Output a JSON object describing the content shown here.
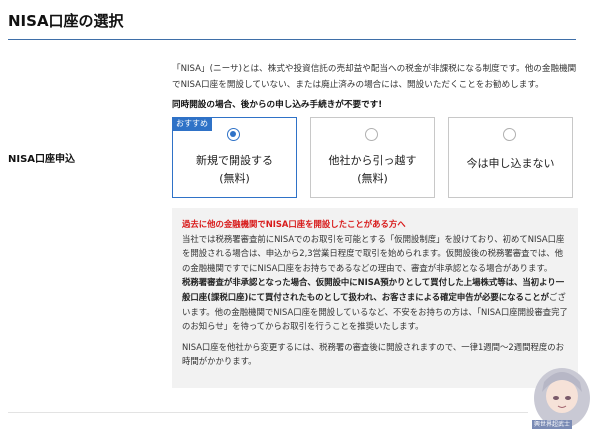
{
  "section": {
    "title": "NISA口座の選択"
  },
  "intro": {
    "text": "「NISA」(ニーサ)とは、株式や投資信託の売却益や配当への税金が非課税になる制度です。他の金融機関でNISA口座を開設していない、または廃止済みの場合には、開設いただくことをお勧めします。",
    "notice": "同時開設の場合、後からの申し込み手続きが不要です!"
  },
  "row": {
    "label": "NISA口座申込"
  },
  "options": [
    {
      "badge": "おすすめ",
      "label": "新規で開設する",
      "sub": "(無料)",
      "selected": true
    },
    {
      "label": "他社から引っ越す",
      "sub": "(無料)",
      "selected": false
    },
    {
      "label": "今は申し込まない",
      "sub": "",
      "selected": false
    }
  ],
  "info": {
    "warning_heading": "過去に他の金融機関でNISA口座を開設したことがある方へ",
    "paragraph1": "当社では税務署審査前にNISAでのお取引を可能とする「仮開設制度」を設けており、初めてNISA口座を開設される場合は、申込から2,3営業日程度で取引を始められます。仮開設後の税務署審査では、他の金融機関ですでにNISA口座をお持ちであるなどの理由で、審査が非承認となる場合があります。",
    "paragraph2_bold": "税務署審査が非承認となった場合、仮開設中にNISA預かりとして買付した上場株式等は、当初より一般口座(課税口座)にて買付されたものとして扱われ、お客さまによる確定申告が必要になることが",
    "paragraph2_rest": "ございます。他の金融機関でNISA口座を開設しているなど、不安をお持ちの方は、「NISA口座開設審査完了のお知らせ」を待ってからお取引を行うことを推奨いたします。",
    "paragraph3": "NISA口座を他社から変更するには、税務署の審査後に開設されますので、一律1週間〜2週間程度のお時間がかかります。"
  },
  "watermark": {
    "text": "興世界超武士"
  },
  "colors": {
    "accent": "#2f72c7",
    "warning": "#d81b1b",
    "rule": "#3f6fa8",
    "info_bg": "#f2f2f2"
  }
}
